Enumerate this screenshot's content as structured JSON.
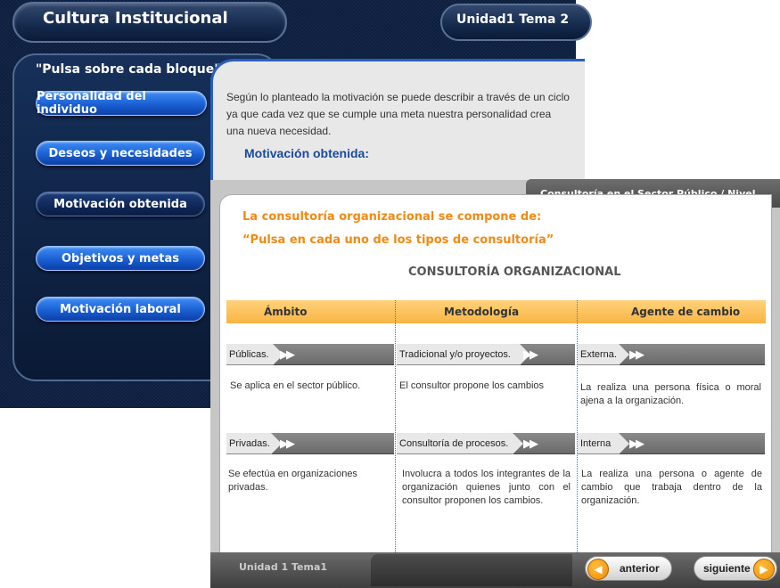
{
  "background_window": {
    "title": "Cultura Institucional",
    "unit_label": "Unidad1  Tema 2",
    "instruction": "\"Pulsa sobre cada bloque\"",
    "menu": [
      {
        "label": "Personalidad del individuo"
      },
      {
        "label": "Deseos y necesidades"
      },
      {
        "label": "Motivación obtenida"
      },
      {
        "label": "Objetivos y metas"
      },
      {
        "label": "Motivación laboral"
      }
    ],
    "content_text": "Según lo planteado la motivación se puede describir a través de un ciclo ya que cada vez que se cumple una meta nuestra personalidad crea una nueva necesidad.",
    "section_heading": "Motivación obtenida:"
  },
  "foreground_window": {
    "header": "Consultoría en el Sector Público / Nivel Básico",
    "heading1": "La consultoría organizacional se compone de:",
    "heading2": "“Pulsa en cada uno de los tipos de consultoría”",
    "table_title": "CONSULTORÍA ORGANIZACIONAL",
    "columns": [
      "Ámbito",
      "Metodología",
      "Agente de cambio"
    ],
    "rows": [
      [
        {
          "type": "Públicas.",
          "desc": "Se aplica en el sector público."
        },
        {
          "type": "Tradicional y/o proyectos.",
          "desc": "El consultor propone los cambios"
        },
        {
          "type": "Externa.",
          "desc": "La realiza una persona física o moral ajena a la organización."
        }
      ],
      [
        {
          "type": "Privadas.",
          "desc": "Se efectúa en organizaciones privadas."
        },
        {
          "type": "Consultoría de procesos.",
          "desc": "Involucra a todos los integrantes de la organización quienes junto con el consultor proponen los cambios."
        },
        {
          "type": "Interna",
          "desc": "La realiza una persona o agente de cambio que trabaja dentro de la organización."
        }
      ]
    ],
    "footer": {
      "unit_label": "Unidad 1 Tema1",
      "prev_label": "anterior",
      "next_label": "siguiente"
    }
  },
  "colors": {
    "accent_orange": "#f08a14",
    "header_bar": "#f9b545",
    "menu_blue": "#1a5fd3",
    "heading_blue": "#1a4a9c"
  }
}
